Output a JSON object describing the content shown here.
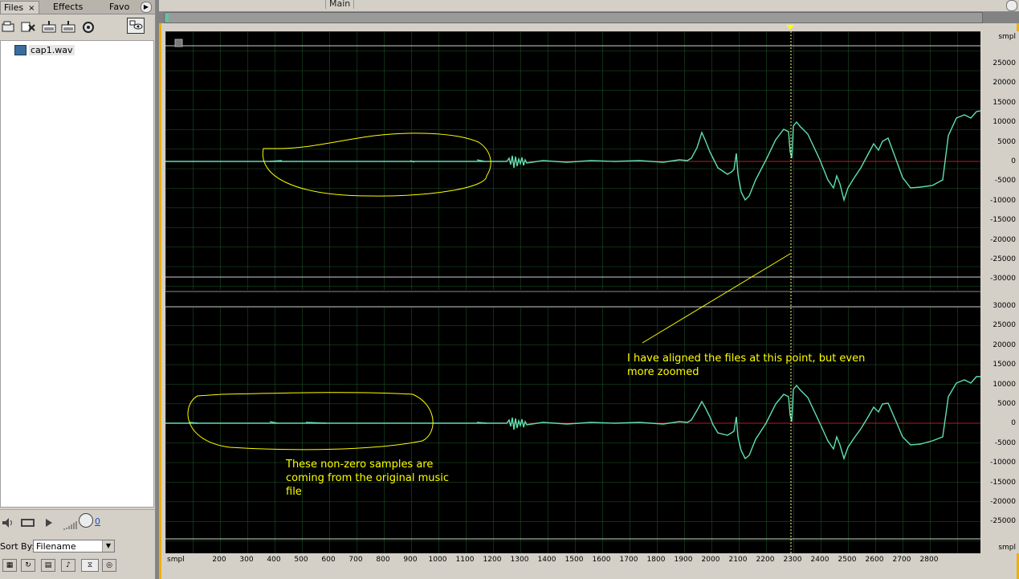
{
  "left_panel": {
    "tabs": [
      {
        "label": "Files",
        "close": "×"
      },
      {
        "label": "Effects"
      },
      {
        "label": "Favo"
      }
    ],
    "files": [
      {
        "name": "cap1.wav"
      }
    ],
    "transport": {
      "counter": "0"
    },
    "sort": {
      "label": "Sort By:",
      "value": "Filename"
    }
  },
  "main": {
    "tab_label": "Main",
    "v_ruler": {
      "unit_top": "smpl",
      "unit_bottom": "smpl",
      "top_channel": [
        "25000",
        "20000",
        "15000",
        "10000",
        "5000",
        "0",
        "-5000",
        "-10000",
        "-15000",
        "-20000",
        "-25000",
        "-30000"
      ],
      "bottom_channel": [
        "30000",
        "25000",
        "20000",
        "15000",
        "10000",
        "5000",
        "0",
        "-5000",
        "-10000",
        "-15000",
        "-20000",
        "-25000"
      ]
    },
    "h_ruler": {
      "unit": "smpl",
      "ticks": [
        "200",
        "300",
        "400",
        "500",
        "600",
        "700",
        "800",
        "900",
        "1000",
        "1100",
        "1200",
        "1300",
        "1400",
        "1500",
        "1600",
        "1700",
        "1800",
        "1900",
        "2000",
        "2100",
        "2200",
        "2300",
        "2400",
        "2500",
        "2600",
        "2700",
        "2800"
      ]
    },
    "annotations": {
      "aligned_line1": "I have aligned the files at this point, but even",
      "aligned_line2": "more zoomed",
      "nonzero_line1": "These non-zero samples are",
      "nonzero_line2": "coming from the original music",
      "nonzero_line3": "file"
    },
    "colors": {
      "waveform": "#5fe0b0",
      "zero_line": "#b02020",
      "grid": "#1f5a2a",
      "annotation": "#ffff00",
      "frame_border": "#f0b000"
    }
  }
}
